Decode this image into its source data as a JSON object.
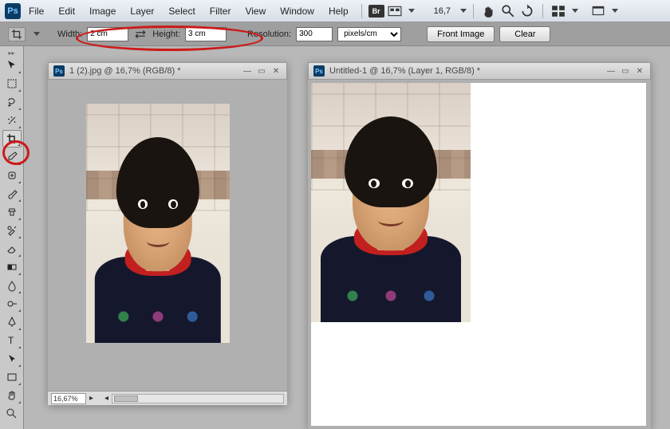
{
  "menu": {
    "items": [
      "File",
      "Edit",
      "Image",
      "Layer",
      "Select",
      "Filter",
      "View",
      "Window",
      "Help"
    ],
    "bridge": "Br",
    "zoom": "16,7"
  },
  "options": {
    "width_label": "Width:",
    "width_value": "2 cm",
    "height_label": "Height:",
    "height_value": "3 cm",
    "resolution_label": "Resolution:",
    "resolution_value": "300",
    "units": "pixels/cm",
    "front_image": "Front Image",
    "clear": "Clear"
  },
  "doc1": {
    "title": "1 (2).jpg @ 16,7% (RGB/8) *",
    "status_zoom": "16,67%"
  },
  "doc2": {
    "title": "Untitled-1 @ 16,7% (Layer 1, RGB/8) *"
  },
  "tools": [
    "move-tool",
    "marquee-tool",
    "lasso-tool",
    "magic-wand-tool",
    "crop-tool",
    "eyedropper-tool",
    "healing-brush-tool",
    "brush-tool",
    "clone-stamp-tool",
    "history-brush-tool",
    "eraser-tool",
    "gradient-tool",
    "blur-tool",
    "dodge-tool",
    "pen-tool",
    "type-tool",
    "path-selection-tool",
    "shape-tool",
    "hand-tool",
    "zoom-tool"
  ]
}
